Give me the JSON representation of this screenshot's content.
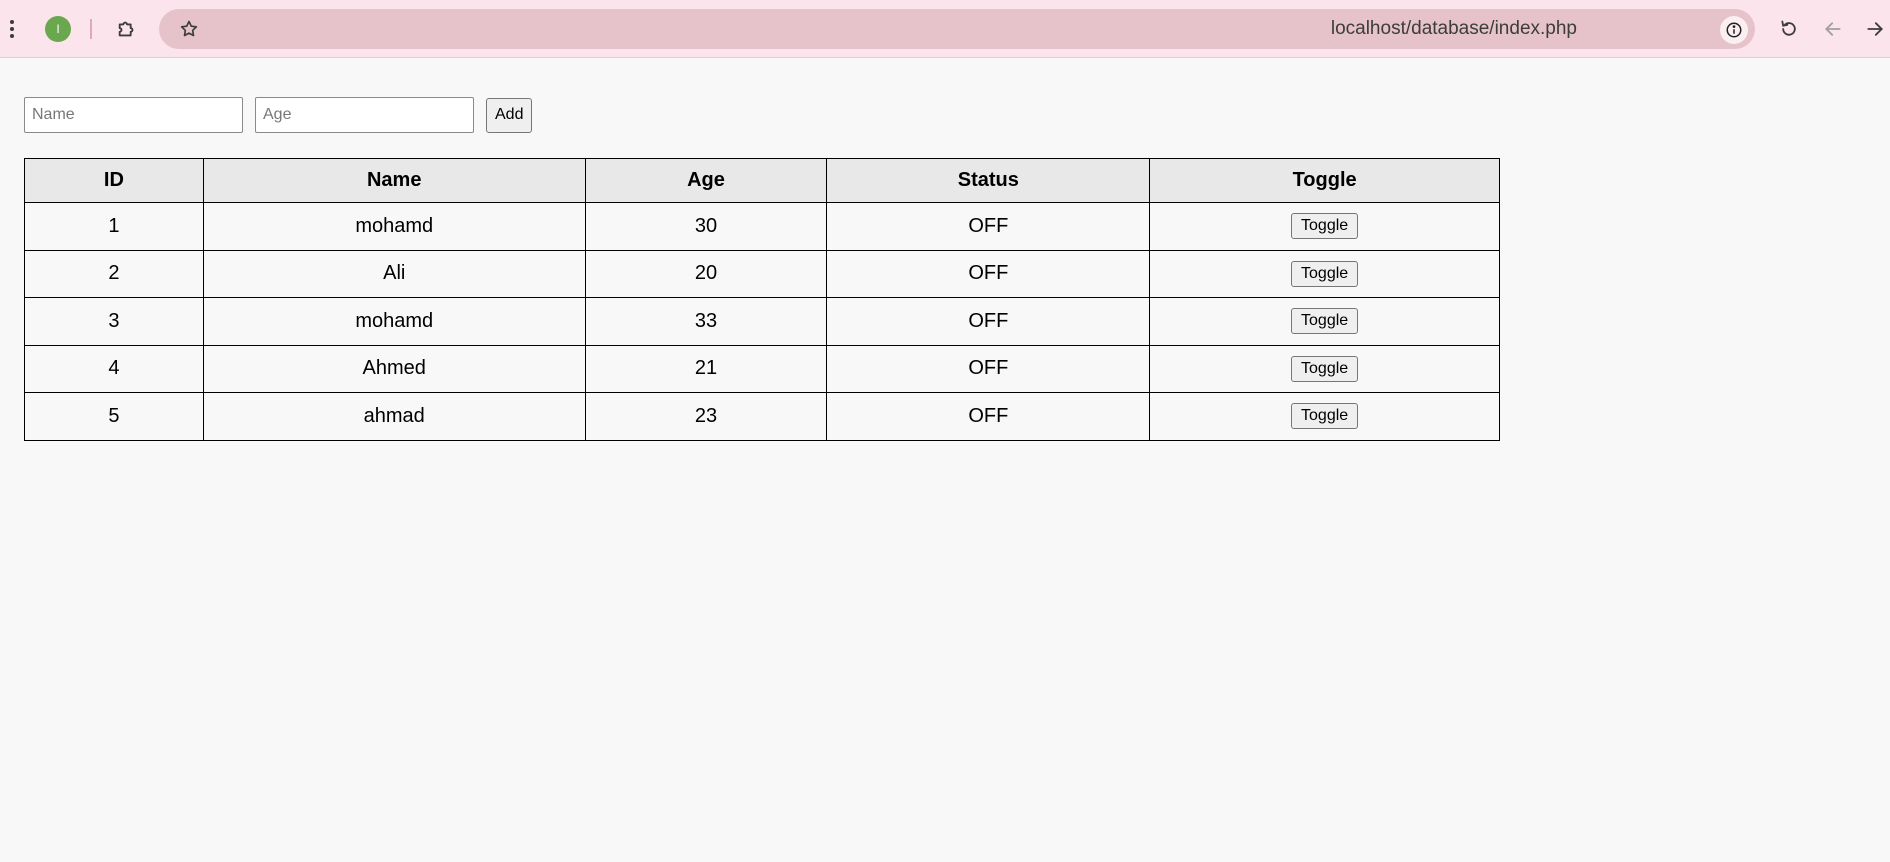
{
  "browser": {
    "profile_initial": "I",
    "url": "localhost/database/index.php"
  },
  "form": {
    "name_placeholder": "Name",
    "age_placeholder": "Age",
    "add_label": "Add"
  },
  "table": {
    "headers": [
      "ID",
      "Name",
      "Age",
      "Status",
      "Toggle"
    ],
    "rows": [
      {
        "id": "1",
        "name": "mohamd",
        "age": "30",
        "status": "OFF",
        "toggle_label": "Toggle"
      },
      {
        "id": "2",
        "name": "Ali",
        "age": "20",
        "status": "OFF",
        "toggle_label": "Toggle"
      },
      {
        "id": "3",
        "name": "mohamd",
        "age": "33",
        "status": "OFF",
        "toggle_label": "Toggle"
      },
      {
        "id": "4",
        "name": "Ahmed",
        "age": "21",
        "status": "OFF",
        "toggle_label": "Toggle"
      },
      {
        "id": "5",
        "name": "ahmad",
        "age": "23",
        "status": "OFF",
        "toggle_label": "Toggle"
      }
    ]
  },
  "icons": {
    "menu": "kebab-menu-icon",
    "extensions": "puzzle-icon",
    "bookmark": "star-icon",
    "site_info": "info-icon",
    "reload": "reload-icon",
    "back": "arrow-left-icon",
    "forward": "arrow-right-icon"
  },
  "colors": {
    "toolbar_bg": "#fce4ec",
    "omnibox_bg": "#e6c3ca",
    "profile_bg": "#6aa84f",
    "header_bg": "#e8e8e8",
    "page_bg": "#f8f8f8"
  }
}
